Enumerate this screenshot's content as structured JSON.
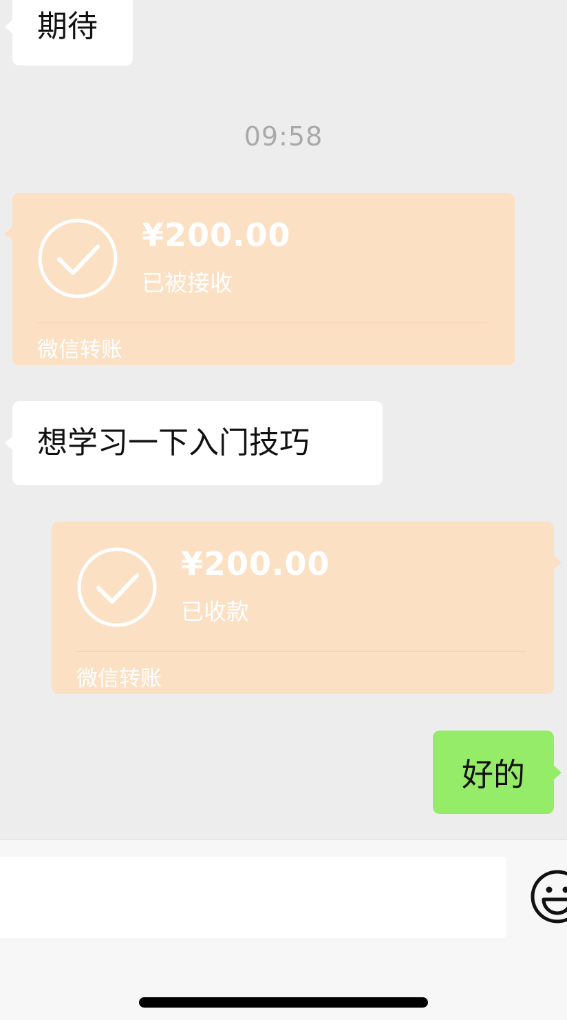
{
  "messages": {
    "m1_text": "期待",
    "timestamp": "09:58",
    "transfer1": {
      "amount": "¥200.00",
      "status": "已被接收",
      "footer": "微信转账"
    },
    "m2_text": "想学习一下入门技巧",
    "transfer2": {
      "amount": "¥200.00",
      "status": "已收款",
      "footer": "微信转账"
    },
    "m3_text": "好的"
  },
  "input_bar": {
    "value": "",
    "emoji_icon": "emoji-smile-icon"
  },
  "colors": {
    "background": "#ededed",
    "incoming_bubble": "#ffffff",
    "outgoing_bubble": "#95ec69",
    "transfer_card": "#fbe0c4"
  }
}
